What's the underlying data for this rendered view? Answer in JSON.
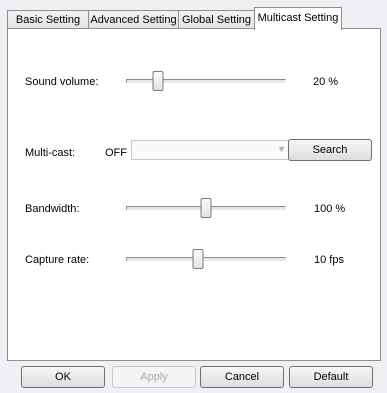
{
  "tabs": [
    {
      "label": "Basic Setting"
    },
    {
      "label": "Advanced Setting"
    },
    {
      "label": "Global Setting"
    },
    {
      "label": "Multicast Setting"
    }
  ],
  "active_tab": "Multicast Setting",
  "sound_volume": {
    "label": "Sound volume:",
    "value_text": "20 %",
    "level": 0.2
  },
  "multicast": {
    "label": "Multi-cast:",
    "state": "OFF",
    "selected": "",
    "search_label": "Search"
  },
  "bandwidth": {
    "label": "Bandwidth:",
    "value_text": "100 %",
    "level": 0.5
  },
  "capture_rate": {
    "label": "Capture rate:",
    "value_text": "10 fps",
    "level": 0.45
  },
  "buttons": {
    "ok": "OK",
    "apply": "Apply",
    "cancel": "Cancel",
    "default": "Default"
  },
  "icons": {
    "dropdown": "chevron-down-icon"
  }
}
